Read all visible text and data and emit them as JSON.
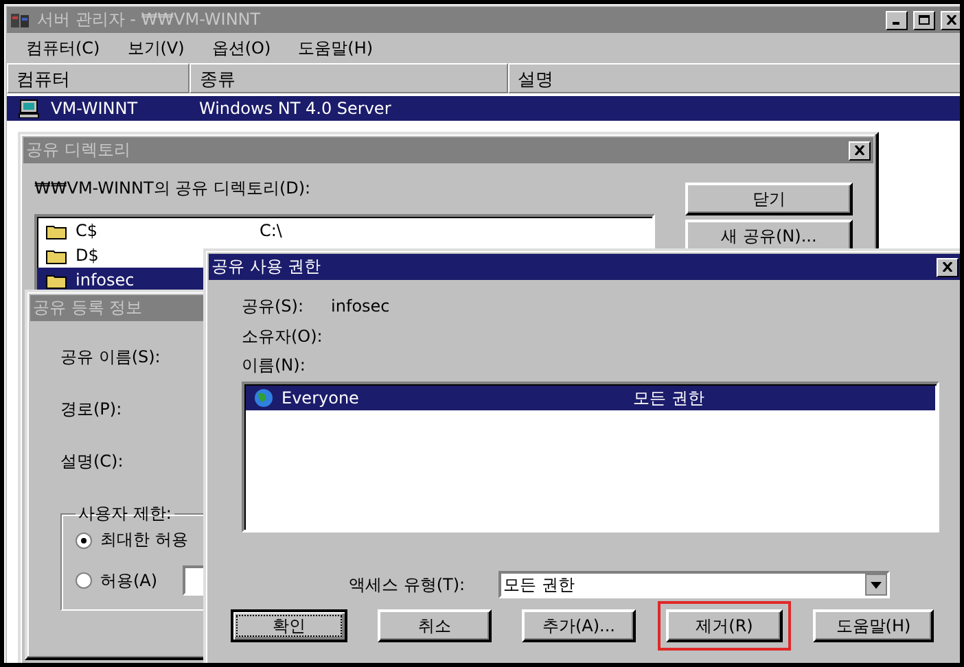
{
  "main_window": {
    "title": "서버 관리자 - ₩₩VM-WINNT",
    "active": false,
    "menu": [
      "컴퓨터(C)",
      "보기(V)",
      "옵션(O)",
      "도움말(H)"
    ],
    "columns": [
      "컴퓨터",
      "종류",
      "설명"
    ],
    "rows": [
      {
        "computer": "VM-WINNT",
        "type": "Windows NT 4.0 Server",
        "selected": true
      }
    ]
  },
  "share_directory_dialog": {
    "title": "공유 디렉토리",
    "active": false,
    "list_label": "₩₩VM-WINNT의 공유 디렉토리(D):",
    "shares": [
      {
        "name": "C$",
        "path": "C:\\",
        "selected": false
      },
      {
        "name": "D$",
        "selected": false
      },
      {
        "name": "infosec",
        "selected": true
      }
    ],
    "buttons": [
      "닫기",
      "새 공유(N)..."
    ]
  },
  "share_properties_dialog": {
    "title": "공유 등록 정보",
    "active": false,
    "fields": [
      "공유 이름(S):",
      "경로(P):",
      "설명(C):"
    ],
    "user_limit": {
      "label": "사용자 제한:",
      "options": [
        {
          "label": "최대한 허용",
          "selected": true
        },
        {
          "label": "허용(A)",
          "selected": false
        }
      ]
    }
  },
  "permissions_dialog": {
    "title": "공유 사용 권한",
    "active": true,
    "share_label": "공유(S):",
    "share_value": "infosec",
    "owner_label": "소유자(O):",
    "names_label": "이름(N):",
    "entries": [
      {
        "name": "Everyone",
        "access": "모든 권한",
        "selected": true
      }
    ],
    "access_type": {
      "label": "액세스 유형(T):",
      "value": "모든 권한"
    },
    "buttons": [
      {
        "label": "확인",
        "focused": true,
        "highlighted": false
      },
      {
        "label": "취소",
        "focused": false,
        "highlighted": false
      },
      {
        "label": "추가(A)...",
        "focused": false,
        "highlighted": false
      },
      {
        "label": "제거(R)",
        "focused": false,
        "highlighted": true
      },
      {
        "label": "도움말(H)",
        "focused": false,
        "highlighted": false
      }
    ]
  }
}
